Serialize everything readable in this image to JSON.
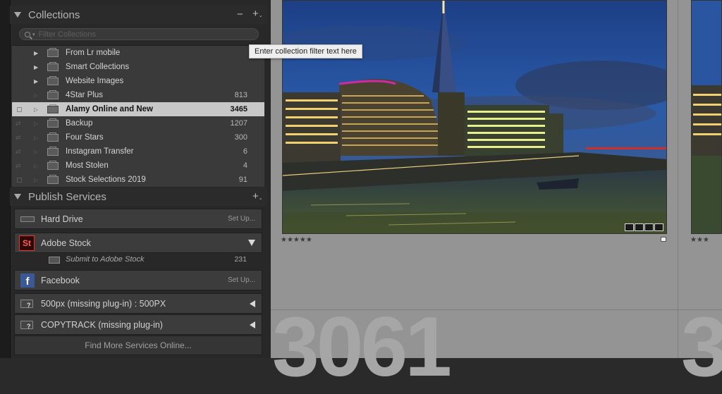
{
  "collections": {
    "title": "Collections",
    "filter_placeholder": "Filter Collections",
    "items": [
      {
        "label": "From Lr mobile",
        "count": "",
        "kind": "set"
      },
      {
        "label": "Smart Collections",
        "count": "",
        "kind": "set"
      },
      {
        "label": "Website Images",
        "count": "",
        "kind": "set"
      },
      {
        "label": "4Star Plus",
        "count": "813",
        "kind": "smart"
      },
      {
        "label": "Alamy Online and New",
        "count": "3465",
        "kind": "collection",
        "selected": true
      },
      {
        "label": "Backup",
        "count": "1207",
        "kind": "collection"
      },
      {
        "label": "Four Stars",
        "count": "300",
        "kind": "collection"
      },
      {
        "label": "Instagram Transfer",
        "count": "6",
        "kind": "collection"
      },
      {
        "label": "Most Stolen",
        "count": "4",
        "kind": "collection"
      },
      {
        "label": "Stock Selections 2019",
        "count": "91",
        "kind": "collection"
      }
    ]
  },
  "tooltip": "Enter collection filter text here",
  "publish": {
    "title": "Publish Services",
    "services": [
      {
        "label": "Hard Drive",
        "right": "Set Up...",
        "icon": "hard-drive-icon"
      },
      {
        "label": "Adobe Stock",
        "right": "",
        "icon": "adobe-stock-icon",
        "icon_text": "St"
      },
      {
        "label": "Facebook",
        "right": "Set Up...",
        "icon": "facebook-icon",
        "icon_text": "f"
      },
      {
        "label": "500px (missing plug-in) : 500PX",
        "right": "",
        "icon": "missing-plugin-folder-icon"
      },
      {
        "label": "COPYTRACK (missing plug-in)",
        "right": "",
        "icon": "missing-plugin-folder-icon"
      }
    ],
    "sub_item": {
      "label": "Submit to Adobe Stock",
      "count": "231"
    },
    "find_more": "Find More Services Online..."
  },
  "grid": {
    "cell_number": "3061",
    "rating_main": "★★★★★",
    "rating_next": "★★★",
    "colors": {
      "grid_bg": "#949494",
      "selected_row": "#c8c8c8",
      "adobe_red": "#e6332a",
      "facebook_blue": "#3b5998"
    }
  }
}
